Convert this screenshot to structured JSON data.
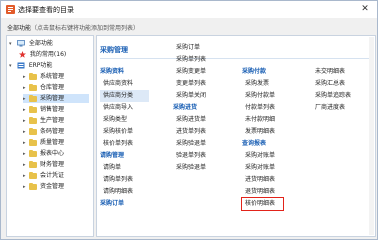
{
  "window": {
    "title": "选择要查看的目录",
    "close_label": "✕"
  },
  "hint": {
    "label": "全部功能",
    "note": "（点击鼠标右键将功能添加到常用列表）"
  },
  "tree": {
    "root": "全部功能",
    "items": [
      {
        "label": "我的常用(16)",
        "level": 1,
        "icon": "star-icon"
      },
      {
        "label": "ERP功能",
        "level": 1,
        "icon": "erp-icon"
      },
      {
        "label": "系统管理",
        "level": 2,
        "icon": "folder-icon"
      },
      {
        "label": "仓库管理",
        "level": 2,
        "icon": "folder-icon"
      },
      {
        "label": "采购管理",
        "level": 2,
        "icon": "folder-icon",
        "selected": true
      },
      {
        "label": "销售管理",
        "level": 2,
        "icon": "folder-icon"
      },
      {
        "label": "生产管理",
        "level": 2,
        "icon": "folder-icon"
      },
      {
        "label": "条码管理",
        "level": 2,
        "icon": "folder-icon"
      },
      {
        "label": "质量管理",
        "level": 2,
        "icon": "folder-icon"
      },
      {
        "label": "报表中心",
        "level": 2,
        "icon": "folder-icon"
      },
      {
        "label": "财务管理",
        "level": 2,
        "icon": "folder-icon"
      },
      {
        "label": "会计凭证",
        "level": 2,
        "icon": "folder-icon"
      },
      {
        "label": "资金管理",
        "level": 2,
        "icon": "folder-icon"
      }
    ]
  },
  "main": {
    "title": "采购管理",
    "columns": [
      [
        {
          "label": "采购资料",
          "group": true
        },
        {
          "label": "供应商资料"
        },
        {
          "label": "供应商分类",
          "highlight": true
        },
        {
          "label": "供应商导入"
        },
        {
          "label": "采购类型"
        },
        {
          "label": "采购核价单"
        },
        {
          "label": "核价单列表"
        },
        {
          "label": "请购管理",
          "group": true
        },
        {
          "label": "请购单"
        },
        {
          "label": "请购单列表"
        },
        {
          "label": "请购明细表"
        },
        {
          "label": "采购订单",
          "group": true
        }
      ],
      [
        {
          "label": "采购订单"
        },
        {
          "label": "采购单列表"
        },
        {
          "label": "采购变更单"
        },
        {
          "label": "变更单列表"
        },
        {
          "label": "采购单关闭"
        },
        {
          "label": "采购进货",
          "group": true
        },
        {
          "label": "采购进货单"
        },
        {
          "label": "进货单列表"
        },
        {
          "label": "采购验退单"
        },
        {
          "label": "验退单列表"
        },
        {
          "label": "采购验退单"
        }
      ],
      [
        {
          "label": "采购付款",
          "group": true
        },
        {
          "label": "采购发票"
        },
        {
          "label": "采购付款单"
        },
        {
          "label": "付款单列表"
        },
        {
          "label": "未付款明细"
        },
        {
          "label": "发票明细表"
        },
        {
          "label": "查询报表",
          "group": true
        },
        {
          "label": "采购对账单"
        },
        {
          "label": "采购对账单"
        },
        {
          "label": "进货明细表"
        },
        {
          "label": "退货明细表"
        },
        {
          "label": "核价明细表",
          "boxed": true
        }
      ],
      [
        {
          "label": "未交明细表"
        },
        {
          "label": "采购汇总表"
        },
        {
          "label": "采购单追踪表"
        },
        {
          "label": "厂商进度表"
        }
      ]
    ]
  },
  "colors": {
    "accent": "#1a5fb4",
    "selected_bg": "#cfe4fb",
    "highlight_box": "#e2231a",
    "folder": "#e8c24b"
  }
}
